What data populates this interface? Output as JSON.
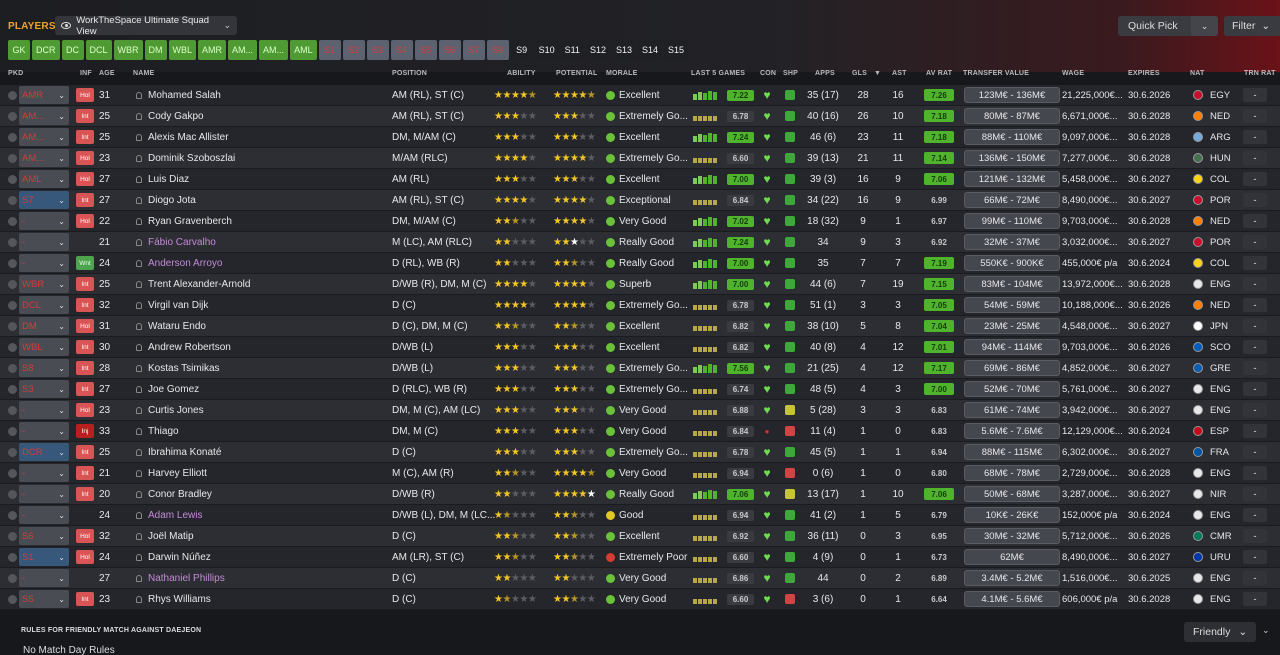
{
  "header": {
    "title": "PLAYERS",
    "view": "WorkTheSpace Ultimate Squad View",
    "quick_pick": "Quick Pick",
    "filter": "Filter"
  },
  "chips": [
    {
      "label": "GK",
      "style": "g"
    },
    {
      "label": "DCR",
      "style": "g"
    },
    {
      "label": "DC",
      "style": "g"
    },
    {
      "label": "DCL",
      "style": "g"
    },
    {
      "label": "WBR",
      "style": "g"
    },
    {
      "label": "DM",
      "style": "g"
    },
    {
      "label": "WBL",
      "style": "g"
    },
    {
      "label": "AMR",
      "style": "g"
    },
    {
      "label": "AM...",
      "style": "g"
    },
    {
      "label": "AM...",
      "style": "g"
    },
    {
      "label": "AML",
      "style": "g"
    },
    {
      "label": "S1",
      "style": "r"
    },
    {
      "label": "S2",
      "style": "r"
    },
    {
      "label": "S3",
      "style": "r"
    },
    {
      "label": "S4",
      "style": "r"
    },
    {
      "label": "S5",
      "style": "r"
    },
    {
      "label": "S6",
      "style": "r"
    },
    {
      "label": "S7",
      "style": "r"
    },
    {
      "label": "S8",
      "style": "r"
    },
    {
      "label": "S9",
      "style": "s"
    },
    {
      "label": "S10",
      "style": "s"
    },
    {
      "label": "S11",
      "style": "s"
    },
    {
      "label": "S12",
      "style": "s"
    },
    {
      "label": "S13",
      "style": "s"
    },
    {
      "label": "S14",
      "style": "s"
    },
    {
      "label": "S15",
      "style": "s"
    }
  ],
  "columns": {
    "pkd": "PKD",
    "inf": "INF",
    "age": "AGE",
    "name": "NAME",
    "position": "POSITION",
    "ability": "ABILITY",
    "potential": "POTENTIAL",
    "morale": "MORALE",
    "last5": "LAST 5 GAMES",
    "con": "CON",
    "shp": "SHP",
    "apps": "APPS",
    "gls": "GLS",
    "ast": "AST",
    "avrat": "AV RAT",
    "tv": "TRANSFER VALUE",
    "wage": "WAGE",
    "expires": "EXPIRES",
    "nat": "NAT",
    "trn": "TRN RAT"
  },
  "players": [
    {
      "pkd": "AMR",
      "inf": "Hol",
      "age": "31",
      "name": "Mohamed Salah",
      "pos": "AM (RL), ST (C)",
      "ab": 4.5,
      "pot": 4.5,
      "morale": "Excellent",
      "m": "good",
      "form": "7.22",
      "fg": true,
      "con": "heart",
      "shp": "g",
      "apps": "35 (17)",
      "gls": "28",
      "ast": "16",
      "avr": "7.26",
      "ag": true,
      "tv": "123M€ - 136M€",
      "wage": "21,225,000€...",
      "exp": "30.6.2026",
      "nat": "EGY"
    },
    {
      "pkd": "AM...",
      "inf": "Int",
      "age": "25",
      "name": "Cody Gakpo",
      "pos": "AM (RL), ST (C)",
      "ab": 3,
      "pot": 3,
      "morale": "Extremely Go...",
      "m": "good",
      "form": "6.78",
      "fg": false,
      "con": "heart",
      "shp": "g",
      "apps": "40 (16)",
      "gls": "26",
      "ast": "10",
      "avr": "7.18",
      "ag": true,
      "tv": "80M€ - 87M€",
      "wage": "6,671,000€...",
      "exp": "30.6.2028",
      "nat": "NED"
    },
    {
      "pkd": "AM...",
      "inf": "Int",
      "age": "25",
      "name": "Alexis Mac Allister",
      "pos": "DM, M/AM (C)",
      "ab": 3,
      "pot": 3,
      "morale": "Excellent",
      "m": "good",
      "form": "7.24",
      "fg": true,
      "con": "heart",
      "shp": "g",
      "apps": "46 (6)",
      "gls": "23",
      "ast": "11",
      "avr": "7.18",
      "ag": true,
      "tv": "88M€ - 110M€",
      "wage": "9,097,000€...",
      "exp": "30.6.2028",
      "nat": "ARG"
    },
    {
      "pkd": "AM...",
      "inf": "Hol",
      "age": "23",
      "name": "Dominik Szoboszlai",
      "pos": "M/AM (RLC)",
      "ab": 4,
      "pot": 4,
      "morale": "Extremely Go...",
      "m": "good",
      "form": "6.60",
      "fg": false,
      "con": "heart",
      "shp": "g",
      "apps": "39 (13)",
      "gls": "21",
      "ast": "11",
      "avr": "7.14",
      "ag": true,
      "tv": "136M€ - 150M€",
      "wage": "7,277,000€...",
      "exp": "30.6.2028",
      "nat": "HUN"
    },
    {
      "pkd": "AML",
      "inf": "Hol",
      "age": "27",
      "name": "Luis Diaz",
      "pos": "AM (RL)",
      "ab": 3,
      "pot": 3,
      "morale": "Excellent",
      "m": "good",
      "form": "7.00",
      "fg": true,
      "con": "heart",
      "shp": "g",
      "apps": "39 (3)",
      "gls": "16",
      "ast": "9",
      "avr": "7.06",
      "ag": true,
      "tv": "121M€ - 132M€",
      "wage": "5,458,000€...",
      "exp": "30.6.2027",
      "nat": "COL"
    },
    {
      "pkd": "S7",
      "inf": "Int",
      "age": "27",
      "name": "Diogo Jota",
      "pos": "AM (RL), ST (C)",
      "ab": 4,
      "pot": 4,
      "morale": "Exceptional",
      "m": "good",
      "form": "6.84",
      "fg": false,
      "con": "heart",
      "shp": "g",
      "apps": "34 (22)",
      "gls": "16",
      "ast": "9",
      "avr": "6.99",
      "ag": false,
      "tv": "66M€ - 72M€",
      "wage": "8,490,000€...",
      "exp": "30.6.2027",
      "nat": "POR"
    },
    {
      "pkd": "-",
      "inf": "Hol",
      "age": "22",
      "name": "Ryan Gravenberch",
      "pos": "DM, M/AM (C)",
      "ab": 2.5,
      "pot": 4,
      "morale": "Very Good",
      "m": "good",
      "form": "7.02",
      "fg": true,
      "con": "heart",
      "shp": "g",
      "apps": "18 (32)",
      "gls": "9",
      "ast": "1",
      "avr": "6.97",
      "ag": false,
      "tv": "99M€ - 110M€",
      "wage": "9,703,000€...",
      "exp": "30.6.2028",
      "nat": "NED"
    },
    {
      "pkd": "-",
      "inf": "",
      "age": "21",
      "name": "Fábio Carvalho",
      "loan": true,
      "pos": "M (LC), AM (RLC)",
      "ab": 2,
      "pot": 2,
      "potw": 1,
      "morale": "Really Good",
      "m": "good",
      "form": "7.24",
      "fg": true,
      "con": "heart",
      "shp": "g",
      "apps": "34",
      "gls": "9",
      "ast": "3",
      "avr": "6.92",
      "ag": false,
      "tv": "32M€ - 37M€",
      "wage": "3,032,000€...",
      "exp": "30.6.2027",
      "nat": "POR"
    },
    {
      "pkd": "-",
      "inf": "Wnt",
      "age": "24",
      "name": "Anderson Arroyo",
      "loan": true,
      "pos": "D (RL), WB (R)",
      "ab": 2,
      "pot": 2.5,
      "morale": "Really Good",
      "m": "good",
      "form": "7.00",
      "fg": true,
      "con": "heart",
      "shp": "g",
      "apps": "35",
      "gls": "7",
      "ast": "7",
      "avr": "7.19",
      "ag": true,
      "tv": "550K€ - 900K€",
      "wage": "455,000€ p/a",
      "exp": "30.6.2024",
      "nat": "COL"
    },
    {
      "pkd": "WBR",
      "inf": "Int",
      "age": "25",
      "name": "Trent Alexander-Arnold",
      "pos": "D/WB (R), DM, M (C)",
      "ab": 4,
      "pot": 4,
      "morale": "Superb",
      "m": "good",
      "form": "7.00",
      "fg": true,
      "con": "heart",
      "shp": "g",
      "apps": "44 (6)",
      "gls": "7",
      "ast": "19",
      "avr": "7.15",
      "ag": true,
      "tv": "83M€ - 104M€",
      "wage": "13,972,000€...",
      "exp": "30.6.2028",
      "nat": "ENG"
    },
    {
      "pkd": "DCL",
      "inf": "Int",
      "age": "32",
      "name": "Virgil van Dijk",
      "pos": "D (C)",
      "ab": 4,
      "pot": 4,
      "morale": "Extremely Go...",
      "m": "good",
      "form": "6.78",
      "fg": false,
      "con": "heart",
      "shp": "g",
      "apps": "51 (1)",
      "gls": "3",
      "ast": "3",
      "avr": "7.05",
      "ag": true,
      "tv": "54M€ - 59M€",
      "wage": "10,188,000€...",
      "exp": "30.6.2026",
      "nat": "NED"
    },
    {
      "pkd": "DM",
      "inf": "Hol",
      "age": "31",
      "name": "Wataru Endo",
      "pos": "D (C), DM, M (C)",
      "ab": 2.5,
      "pot": 2.5,
      "morale": "Excellent",
      "m": "good",
      "form": "6.82",
      "fg": false,
      "con": "heart",
      "shp": "g",
      "apps": "38 (10)",
      "gls": "5",
      "ast": "8",
      "avr": "7.04",
      "ag": true,
      "tv": "23M€ - 25M€",
      "wage": "4,548,000€...",
      "exp": "30.6.2027",
      "nat": "JPN"
    },
    {
      "pkd": "WBL",
      "inf": "Int",
      "age": "30",
      "name": "Andrew Robertson",
      "pos": "D/WB (L)",
      "ab": 3,
      "pot": 3,
      "morale": "Excellent",
      "m": "good",
      "form": "6.82",
      "fg": false,
      "con": "heart",
      "shp": "g",
      "apps": "40 (8)",
      "gls": "4",
      "ast": "12",
      "avr": "7.01",
      "ag": true,
      "tv": "94M€ - 114M€",
      "wage": "9,703,000€...",
      "exp": "30.6.2026",
      "nat": "SCO"
    },
    {
      "pkd": "S8",
      "inf": "Int",
      "age": "28",
      "name": "Kostas Tsimikas",
      "pos": "D/WB (L)",
      "ab": 3,
      "pot": 3,
      "morale": "Extremely Go...",
      "m": "good",
      "form": "7.56",
      "fg": true,
      "con": "heart",
      "shp": "g",
      "apps": "21 (25)",
      "gls": "4",
      "ast": "12",
      "avr": "7.17",
      "ag": true,
      "tv": "69M€ - 86M€",
      "wage": "4,852,000€...",
      "exp": "30.6.2027",
      "nat": "GRE"
    },
    {
      "pkd": "S3",
      "inf": "Int",
      "age": "27",
      "name": "Joe Gomez",
      "pos": "D (RLC), WB (R)",
      "ab": 3,
      "pot": 3,
      "morale": "Extremely Go...",
      "m": "good",
      "form": "6.74",
      "fg": false,
      "con": "heart",
      "shp": "g",
      "apps": "48 (5)",
      "gls": "4",
      "ast": "3",
      "avr": "7.00",
      "ag": true,
      "tv": "52M€ - 70M€",
      "wage": "5,761,000€...",
      "exp": "30.6.2027",
      "nat": "ENG"
    },
    {
      "pkd": "-",
      "inf": "Hol",
      "age": "23",
      "name": "Curtis Jones",
      "pos": "DM, M (C), AM (LC)",
      "ab": 3,
      "pot": 3,
      "morale": "Very Good",
      "m": "good",
      "form": "6.88",
      "fg": false,
      "con": "heart",
      "shp": "y",
      "apps": "5 (28)",
      "gls": "3",
      "ast": "3",
      "avr": "6.83",
      "ag": false,
      "tv": "61M€ - 74M€",
      "wage": "3,942,000€...",
      "exp": "30.6.2027",
      "nat": "ENG"
    },
    {
      "pkd": "-",
      "inf": "Inj",
      "age": "33",
      "name": "Thiago",
      "pos": "DM, M (C)",
      "ab": 3,
      "pot": 3,
      "morale": "Very Good",
      "m": "good",
      "form": "6.84",
      "fg": false,
      "con": "inj",
      "shp": "r",
      "apps": "11 (4)",
      "gls": "1",
      "ast": "0",
      "avr": "6.83",
      "ag": false,
      "tv": "5.6M€ - 7.6M€",
      "wage": "12,129,000€...",
      "exp": "30.6.2024",
      "nat": "ESP"
    },
    {
      "pkd": "DCR",
      "inf": "Int",
      "age": "25",
      "name": "Ibrahima Konaté",
      "pos": "D (C)",
      "ab": 3,
      "pot": 3,
      "morale": "Extremely Go...",
      "m": "good",
      "form": "6.78",
      "fg": false,
      "con": "heart",
      "shp": "g",
      "apps": "45 (5)",
      "gls": "1",
      "ast": "1",
      "avr": "6.94",
      "ag": false,
      "tv": "88M€ - 115M€",
      "wage": "6,302,000€...",
      "exp": "30.6.2027",
      "nat": "FRA"
    },
    {
      "pkd": "-",
      "inf": "Int",
      "age": "21",
      "name": "Harvey Elliott",
      "pos": "M (C), AM (R)",
      "ab": 2.5,
      "pot": 4.5,
      "morale": "Very Good",
      "m": "good",
      "form": "6.94",
      "fg": false,
      "con": "heart",
      "shp": "r",
      "apps": "0 (6)",
      "gls": "1",
      "ast": "0",
      "avr": "6.80",
      "ag": false,
      "tv": "68M€ - 78M€",
      "wage": "2,729,000€...",
      "exp": "30.6.2028",
      "nat": "ENG"
    },
    {
      "pkd": "-",
      "inf": "Int",
      "age": "20",
      "name": "Conor Bradley",
      "pos": "D/WB (R)",
      "ab": 2,
      "pot": 4,
      "potw": 1,
      "morale": "Really Good",
      "m": "good",
      "form": "7.06",
      "fg": true,
      "con": "heart",
      "shp": "y",
      "apps": "13 (17)",
      "gls": "1",
      "ast": "10",
      "avr": "7.06",
      "ag": true,
      "tv": "50M€ - 68M€",
      "wage": "3,287,000€...",
      "exp": "30.6.2027",
      "nat": "NIR"
    },
    {
      "pkd": "-",
      "inf": "",
      "age": "24",
      "name": "Adam Lewis",
      "loan": true,
      "pos": "D/WB (L), DM, M (LC...",
      "ab": 1.5,
      "pot": 2.5,
      "morale": "Good",
      "m": "ok",
      "form": "6.94",
      "fg": false,
      "con": "heart",
      "shp": "g",
      "apps": "41 (2)",
      "gls": "1",
      "ast": "5",
      "avr": "6.79",
      "ag": false,
      "tv": "10K€ - 26K€",
      "wage": "152,000€ p/a",
      "exp": "30.6.2024",
      "nat": "ENG"
    },
    {
      "pkd": "S6",
      "inf": "Hol",
      "age": "32",
      "name": "Joël Matip",
      "pos": "D (C)",
      "ab": 2.5,
      "pot": 2.5,
      "morale": "Excellent",
      "m": "good",
      "form": "6.92",
      "fg": false,
      "con": "heart",
      "shp": "g",
      "apps": "36 (11)",
      "gls": "0",
      "ast": "3",
      "avr": "6.95",
      "ag": false,
      "tv": "30M€ - 32M€",
      "wage": "5,712,000€...",
      "exp": "30.6.2026",
      "nat": "CMR"
    },
    {
      "pkd": "S1",
      "inf": "Hol",
      "age": "24",
      "name": "Darwin Núñez",
      "pos": "AM (LR), ST (C)",
      "ab": 2.5,
      "pot": 2.5,
      "morale": "Extremely Poor",
      "m": "poor",
      "form": "6.60",
      "fg": false,
      "con": "heart",
      "shp": "g",
      "apps": "4 (9)",
      "gls": "0",
      "ast": "1",
      "avr": "6.73",
      "ag": false,
      "tv": "62M€",
      "wage": "8,490,000€...",
      "exp": "30.6.2027",
      "nat": "URU"
    },
    {
      "pkd": "-",
      "inf": "",
      "age": "27",
      "name": "Nathaniel Phillips",
      "loan": true,
      "pos": "D (C)",
      "ab": 2,
      "pot": 2,
      "morale": "Very Good",
      "m": "good",
      "form": "6.86",
      "fg": false,
      "con": "heart",
      "shp": "g",
      "apps": "44",
      "gls": "0",
      "ast": "2",
      "avr": "6.89",
      "ag": false,
      "tv": "3.4M€ - 5.2M€",
      "wage": "1,516,000€...",
      "exp": "30.6.2025",
      "nat": "ENG"
    },
    {
      "pkd": "S5",
      "inf": "Int",
      "age": "23",
      "name": "Rhys Williams",
      "pos": "D (C)",
      "ab": 1.5,
      "pot": 2.5,
      "morale": "Very Good",
      "m": "good",
      "form": "6.60",
      "fg": false,
      "con": "heart",
      "shp": "r",
      "apps": "3 (6)",
      "gls": "0",
      "ast": "1",
      "avr": "6.64",
      "ag": false,
      "tv": "4.1M€ - 5.6M€",
      "wage": "606,000€ p/a",
      "exp": "30.6.2028",
      "nat": "ENG"
    }
  ],
  "footer": {
    "rules_title": "RULES FOR FRIENDLY MATCH AGAINST DAEJEON",
    "rules_value": "No Match Day Rules",
    "match_type": "Friendly"
  },
  "colors": {
    "accent": "#f0a22a",
    "good": "#4fb32c",
    "bad": "#d43b3b"
  }
}
